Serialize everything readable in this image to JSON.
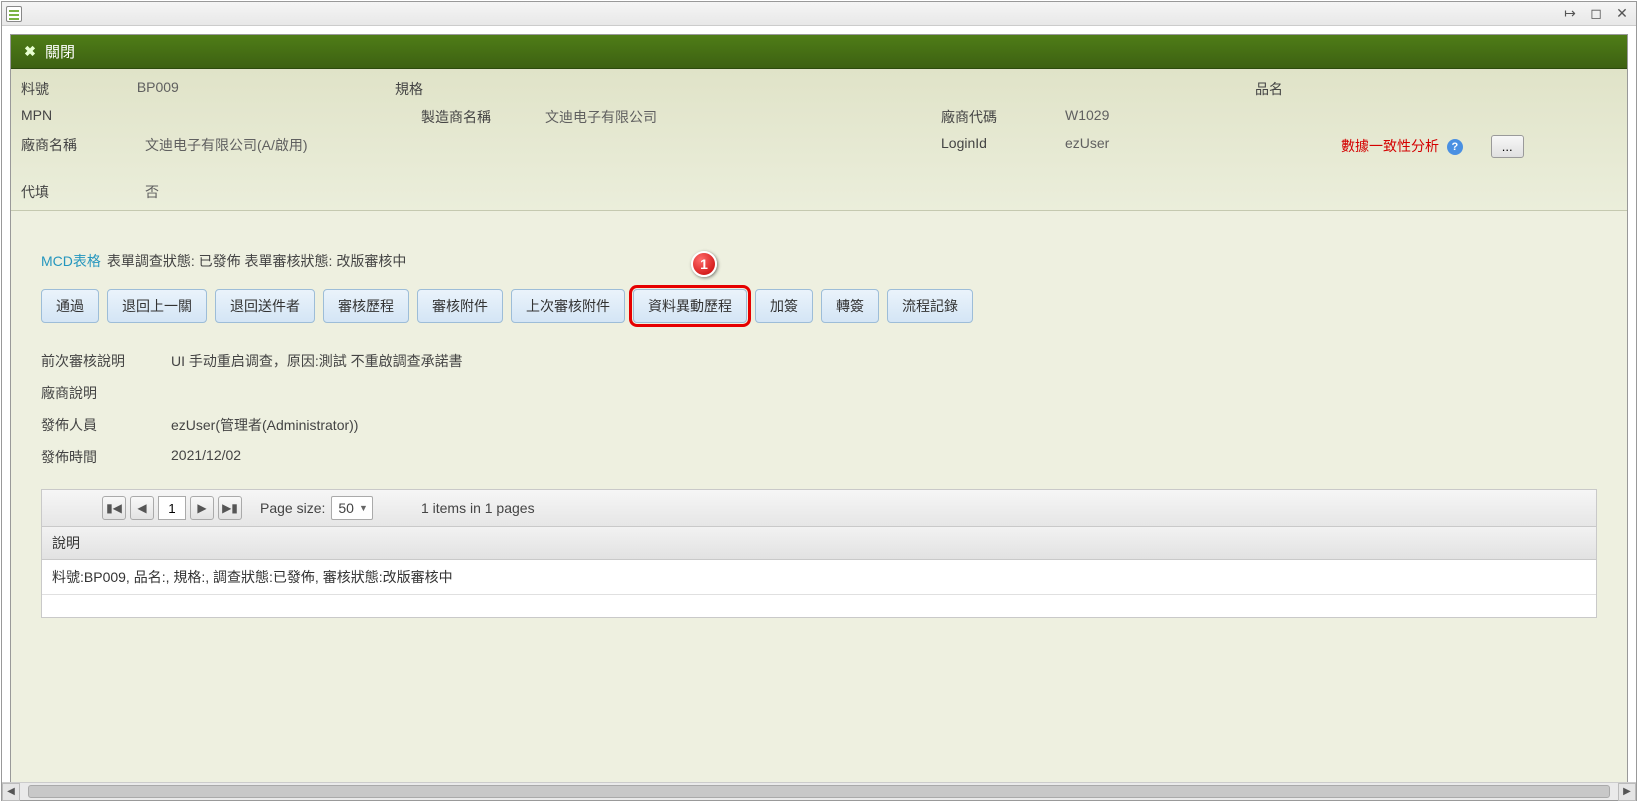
{
  "titlebar": {
    "minimize": "⎯",
    "maximize": "◻",
    "close": "✕",
    "pin": "↦"
  },
  "header": {
    "close_label": "關閉"
  },
  "info": {
    "part_no_label": "料號",
    "part_no_value": "BP009",
    "spec_label": "規格",
    "spec_value": "",
    "product_name_label": "品名",
    "product_name_value": "",
    "mpn_label": "MPN",
    "mpn_value": "",
    "mfr_name_label": "製造商名稱",
    "mfr_name_value": "文迪电子有限公司",
    "vendor_code_label": "廠商代碼",
    "vendor_code_value": "W1029",
    "vendor_name_label": "廠商名稱",
    "vendor_name_value": "文迪电子有限公司(A/啟用)",
    "login_label": "LoginId",
    "login_value": "ezUser",
    "consistency_label": "數據一致性分析",
    "dots_label": "...",
    "substitute_label": "代填",
    "substitute_value": "否"
  },
  "status": {
    "mcd_link": "MCD表格",
    "text": "表單調查狀態: 已發佈 表單審核狀態: 改版審核中"
  },
  "callout": "1",
  "buttons": {
    "b1": "通過",
    "b2": "退回上一關",
    "b3": "退回送件者",
    "b4": "審核歷程",
    "b5": "審核附件",
    "b6": "上次審核附件",
    "b7": "資料異動歷程",
    "b8": "加簽",
    "b9": "轉簽",
    "b10": "流程記錄"
  },
  "details": {
    "prev_review_label": "前次審核說明",
    "prev_review_value": "UI 手动重启调查，原因:測試 不重啟調查承諾書",
    "vendor_desc_label": "廠商說明",
    "vendor_desc_value": "",
    "publisher_label": "發佈人員",
    "publisher_value": "ezUser(管理者(Administrator))",
    "publish_time_label": "發佈時間",
    "publish_time_value": "2021/12/02"
  },
  "grid": {
    "page_current": "1",
    "page_size_label": "Page size:",
    "page_size_value": "50",
    "items_text": "1 items in 1 pages",
    "col_header": "說明",
    "row1": "料號:BP009, 品名:, 規格:, 調查狀態:已發佈, 審核狀態:改版審核中"
  }
}
